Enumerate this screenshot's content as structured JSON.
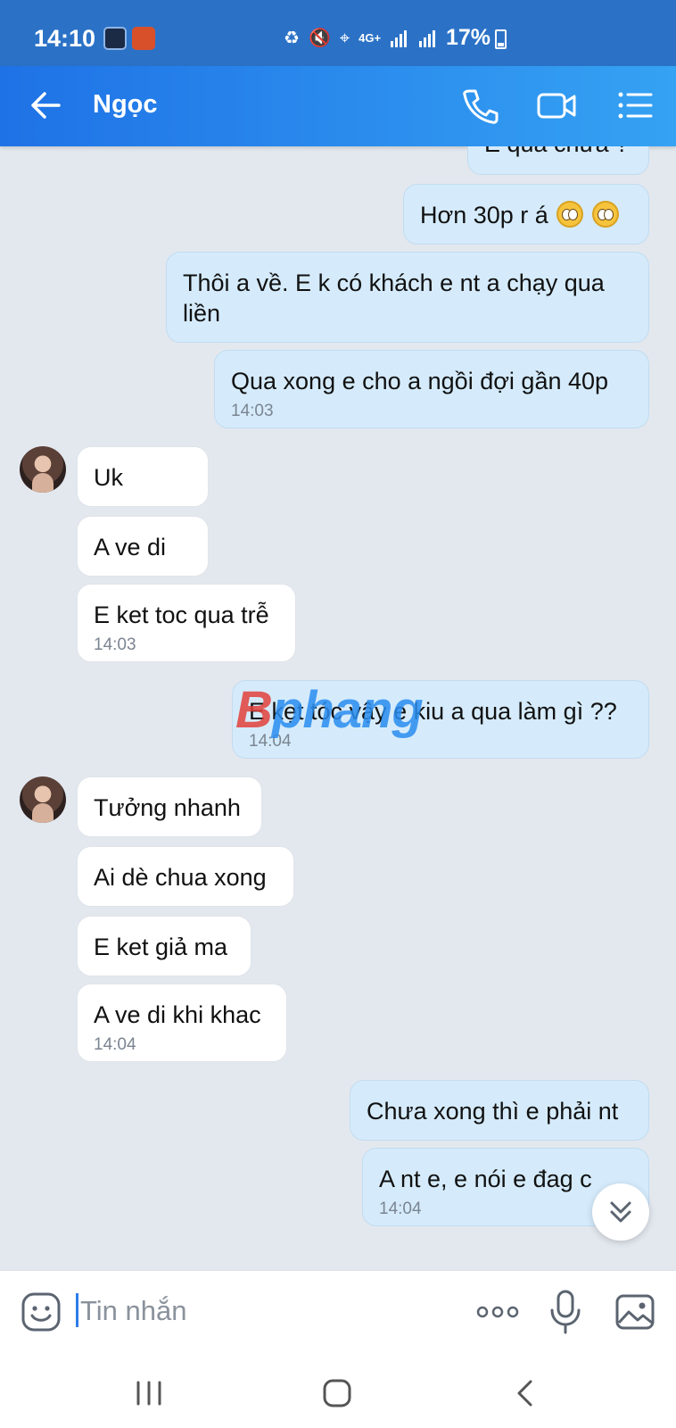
{
  "status_bar": {
    "time": "14:10",
    "network": "4G+",
    "battery": "17%"
  },
  "header": {
    "contact_name": "Ngọc"
  },
  "messages": [
    {
      "side": "me",
      "text": "E qua chưa ?"
    },
    {
      "side": "me",
      "text": "Hơn 30p r á",
      "emoji": "flushed-face x2"
    },
    {
      "side": "me",
      "text_line1": "Thôi a về. E k có khách e nt a chạy qua",
      "text_line2": "liền"
    },
    {
      "side": "me",
      "text": "Qua xong e cho a ngồi đợi gần 40p",
      "time": "14:03"
    },
    {
      "side": "them",
      "text": "Uk"
    },
    {
      "side": "them",
      "text": "A ve di"
    },
    {
      "side": "them",
      "text": "E ket toc qua trễ",
      "time": "14:03"
    },
    {
      "side": "me",
      "text": "E kẹt tóc vậy e kiu a qua làm gì ??",
      "time": "14:04"
    },
    {
      "side": "them",
      "text": "Tưởng nhanh"
    },
    {
      "side": "them",
      "text": "Ai dè chua xong"
    },
    {
      "side": "them",
      "text": "E ket giả ma"
    },
    {
      "side": "them",
      "text": "A ve di khi khac",
      "time": "14:04"
    },
    {
      "side": "me",
      "text": "Chưa xong thì e phải nt"
    },
    {
      "side": "me",
      "text": "A nt e, e nói e đag c",
      "time": "14:04"
    }
  ],
  "watermark": {
    "brand_first": "B",
    "brand_rest": "phang"
  },
  "input": {
    "placeholder": "Tin nhắn"
  },
  "colors": {
    "header_start": "#1f72e6",
    "header_end": "#35a2f3",
    "my_bubble": "#d5ebfb",
    "their_bubble": "#ffffff",
    "chat_background": "#e3e8ef"
  },
  "icons": [
    "back-arrow-icon",
    "phone-icon",
    "video-camera-icon",
    "menu-list-icon",
    "sticker-icon",
    "more-dots-icon",
    "microphone-icon",
    "image-icon",
    "double-chevron-down-icon",
    "recent-apps-icon",
    "home-icon",
    "nav-back-icon"
  ]
}
